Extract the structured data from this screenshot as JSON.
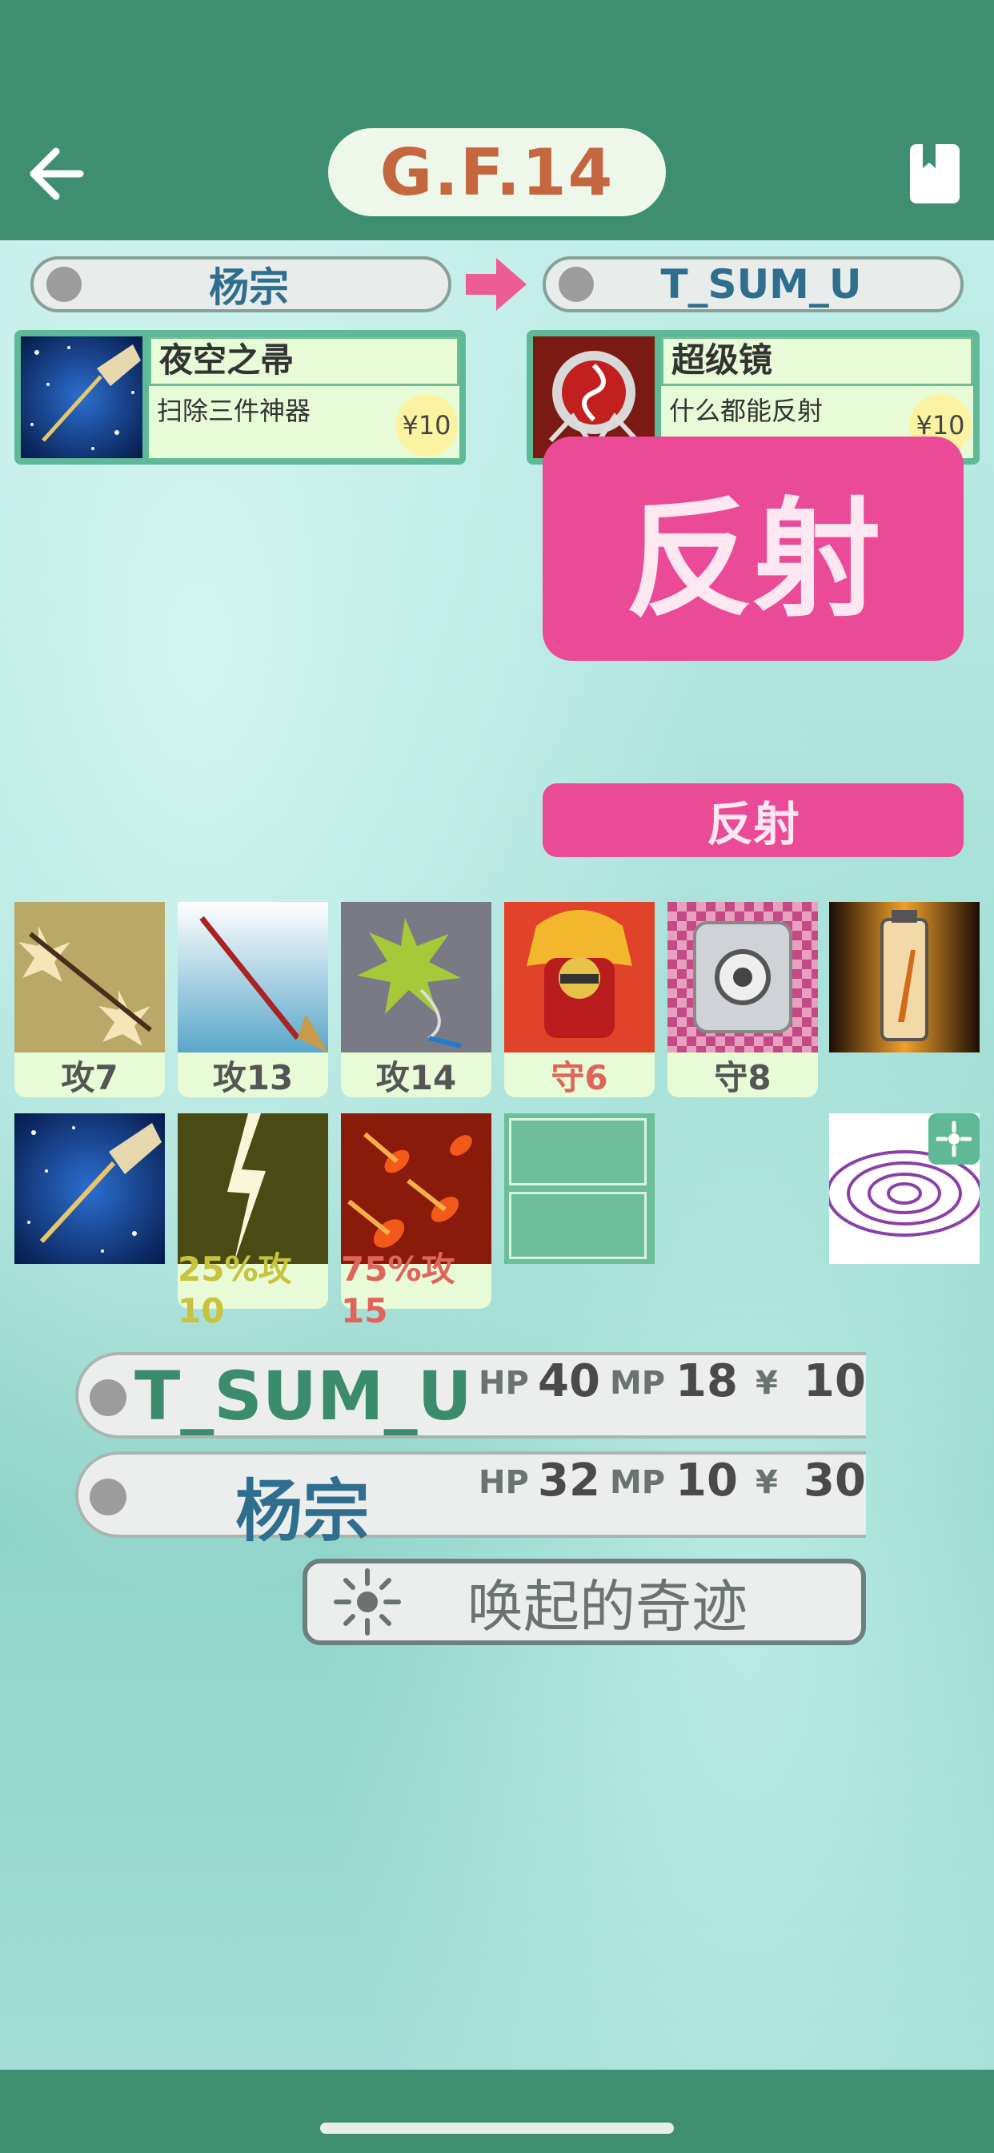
{
  "header": {
    "title": "G.F.14"
  },
  "players": {
    "from": "杨宗",
    "to": "T_SUM_U"
  },
  "cards": [
    {
      "name": "夜空之帚",
      "desc": "扫除三件神器",
      "price": "¥10"
    },
    {
      "name": "超级镜",
      "desc": "什么都能反射",
      "price": "¥10"
    }
  ],
  "reflect": {
    "big": "反射",
    "small": "反射"
  },
  "grid": {
    "row1": [
      {
        "label": "攻7",
        "color": "#555555"
      },
      {
        "label": "攻13",
        "color": "#555555"
      },
      {
        "label": "攻14",
        "color": "#555555"
      },
      {
        "label": "守6",
        "color": "#e0645c"
      },
      {
        "label": "守8",
        "color": "#555555"
      }
    ],
    "row2": [
      {
        "label": "25%攻10",
        "color": "#c8c23c"
      },
      {
        "label": "75%攻15",
        "color": "#e0645c"
      }
    ]
  },
  "status": {
    "p1": {
      "name": "T_SUM_U",
      "hp_label": "HP",
      "hp": "40",
      "mp_label": "MP",
      "mp": "18",
      "yen": "¥",
      "money": "10"
    },
    "p2": {
      "name": "杨宗",
      "hp_label": "HP",
      "hp": "32",
      "mp_label": "MP",
      "mp": "10",
      "yen": "¥",
      "money": "30"
    }
  },
  "miracle": {
    "label": "唤起的奇迹",
    "icon": "sparkle-icon"
  },
  "colors": {
    "topbar": "#3e8f72",
    "accent_pink": "#ea4a96",
    "title": "#c4663f"
  }
}
